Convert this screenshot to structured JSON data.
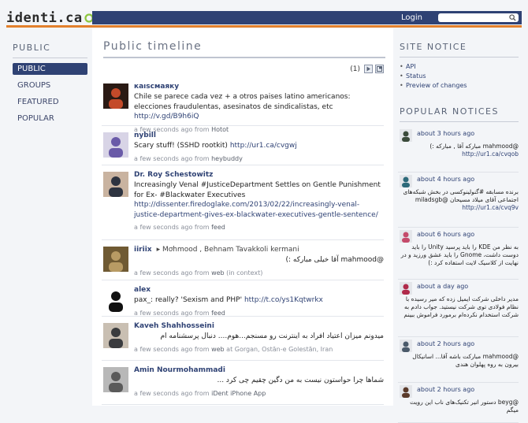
{
  "header": {
    "logo_text": "identi.ca",
    "login_label": "Login",
    "search_placeholder": ""
  },
  "colors": {
    "brand_navy": "#2f4274",
    "accent_orange": "#e2802c",
    "logo_green": "#8dc63f"
  },
  "left_nav": {
    "heading": "PUBLIC",
    "items": [
      {
        "label": "PUBLIC",
        "active": true
      },
      {
        "label": "GROUPS",
        "active": false
      },
      {
        "label": "FEATURED",
        "active": false
      },
      {
        "label": "POPULAR",
        "active": false
      }
    ]
  },
  "main": {
    "title": "Public timeline",
    "pager_count": "(1)",
    "notices": [
      {
        "author": "каıѕсмаяку",
        "recipients": "",
        "text": "Chile se parece cada vez + a otros paises latino americanos: elecciones fraudulentas, asesinatos de sindicalistas, etc ",
        "link": "http://v.gd/B9h6iQ",
        "rtl": false,
        "time": "a few seconds ago",
        "from_label": " from ",
        "source": "Hotot",
        "extra": ""
      },
      {
        "author": "nybill",
        "recipients": "",
        "text": "Scary stuff! (SSHD rootkit) ",
        "link": "http://ur1.ca/cvgwj",
        "rtl": false,
        "time": "a few seconds ago",
        "from_label": " from ",
        "source": "heybuddy",
        "extra": ""
      },
      {
        "author": "Dr. Roy Schestowitz",
        "recipients": "",
        "text": "Increasingly Venal #JusticeDepartment Settles on Gentle Punishment for Ex- #Blackwater Executives ",
        "link": "http://dissenter.firedoglake.com/2013/02/22/increasingly-venal-justice-department-gives-ex-blackwater-executives-gentle-sentence/",
        "rtl": false,
        "time": "a few seconds ago",
        "from_label": " from ",
        "source": "feed",
        "extra": ""
      },
      {
        "author": "iiriix",
        "recipients": "▸ Mơhmood , Behnam Tavakkoli kermani",
        "text": "@mahmood آقا خیلی مبارکه :)",
        "link": "",
        "rtl": true,
        "time": "a few seconds ago",
        "from_label": " from ",
        "source": "web",
        "extra": " (in context)"
      },
      {
        "author": "alex",
        "recipients": "",
        "text": "pax_: really? 'Sexism and PHP' ",
        "link": "http://t.co/ys1Kqtwrkx",
        "rtl": false,
        "time": "a few seconds ago",
        "from_label": " from ",
        "source": "feed",
        "extra": ""
      },
      {
        "author": "Kaveh Shahhosseini",
        "recipients": "",
        "text": "میدونم میزان اعتیاد افراد به اینترنت رو مسنجم...هوم.... دنبال پرسشنامه ام",
        "link": "",
        "rtl": true,
        "time": "a few seconds ago",
        "from_label": " from ",
        "source": "web",
        "extra": " at Gorgan, Ostān-e Golestān, Iran"
      },
      {
        "author": "Amin Nourmohammadi",
        "recipients": "",
        "text": "شماها چرا حواستون نیست به من دگین چقیم چی کرد ...",
        "link": "",
        "rtl": true,
        "time": "a few seconds ago",
        "from_label": " from ",
        "source": "iDent iPhone App",
        "extra": ""
      }
    ]
  },
  "sidebar": {
    "site_notice": {
      "heading": "SITE NOTICE",
      "items": [
        "API",
        "Status",
        "Preview of changes"
      ]
    },
    "popular": {
      "heading": "POPULAR NOTICES",
      "items": [
        {
          "time": "about 3 hours ago",
          "text": "@mahmood مبارکه آقا , مبارکه :)",
          "link": "http://ur1.ca/cvqob"
        },
        {
          "time": "about 4 hours ago",
          "text": "برنده مسابقه #گنولینوکسی در بخش شبکه‌های اجتماعی آقای میلاد مسیحان @miladsgb",
          "link": "http://ur1.ca/cvq9v"
        },
        {
          "time": "about 6 hours ago",
          "text": "به نظر من KDE را باید پرسید Unity را باید دوست داشت، Gnome را باید عشق ورزید و در نهایت از کلاسیک لایت استفاده کرد :)",
          "link": ""
        },
        {
          "time": "about a day ago",
          "text": "مدیر داخلی شرکت ایمیل زده که میر رسیده با نظام فولادی توی شرکت نیستید. جواب دادم به شرکت استخدام نکرده‌ام برمورد فراموش ببینم",
          "link": ""
        },
        {
          "time": "about 2 hours ago",
          "text": "@mahmood مبارکت باشه آقا... اسانیکال بیرون به روه پهلوان هندی",
          "link": ""
        },
        {
          "time": "about 2 hours ago",
          "text": "@beyg دستور انیر تکنیک‌های ناب این رویت میگم",
          "link": ""
        }
      ]
    }
  }
}
